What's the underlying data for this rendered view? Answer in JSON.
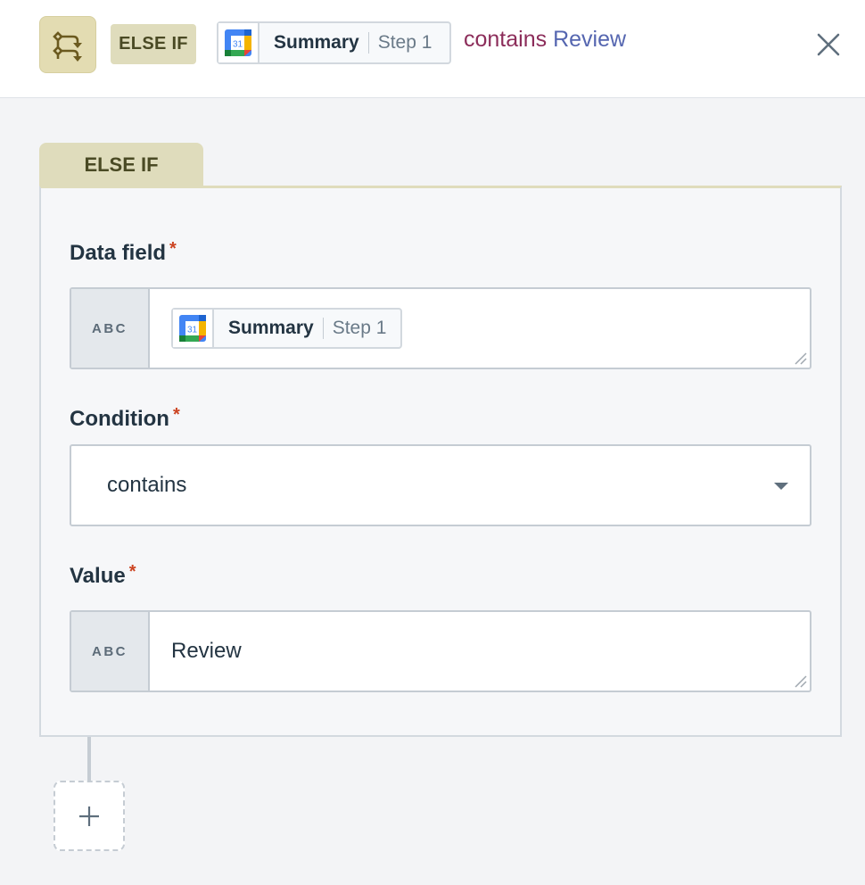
{
  "header": {
    "node_icon": "branch-condition-icon",
    "badge": "ELSE IF",
    "pill": {
      "app_icon": "google-calendar-icon",
      "calendar_day": "31",
      "field": "Summary",
      "step": "Step 1"
    },
    "summary": {
      "condition": "contains",
      "value": "Review"
    },
    "close_icon": "close-icon"
  },
  "tab": {
    "label": "ELSE IF"
  },
  "form": {
    "data_field": {
      "label": "Data field",
      "required_mark": "*",
      "type_label": "ABC",
      "pill": {
        "app_icon": "google-calendar-icon",
        "calendar_day": "31",
        "field": "Summary",
        "step": "Step 1"
      }
    },
    "condition": {
      "label": "Condition",
      "required_mark": "*",
      "selected": "contains"
    },
    "value": {
      "label": "Value",
      "required_mark": "*",
      "type_label": "ABC",
      "text": "Review"
    }
  },
  "add_step": {
    "icon": "plus-icon"
  },
  "colors": {
    "accent_badge_bg": "#dfdcbc",
    "accent_badge_text": "#4a4a24",
    "condition_text": "#8c2d5a",
    "value_text": "#5566b0",
    "required": "#cc4422"
  }
}
